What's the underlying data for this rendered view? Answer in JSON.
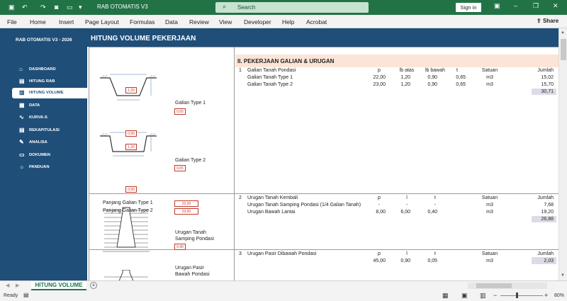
{
  "titlebar": {
    "title": "RAB OTOMATIS V3",
    "search_placeholder": "Search",
    "signin_label": "Sign in",
    "autosave_icon": "save-icon"
  },
  "ribbon": {
    "tabs": [
      "File",
      "Home",
      "Insert",
      "Page Layout",
      "Formulas",
      "Data",
      "Review",
      "View",
      "Developer",
      "Help",
      "Acrobat"
    ],
    "share_label": "Share"
  },
  "header": {
    "brand": "RAB OTOMATIS V3 - 2026",
    "page_title": "HITUNG VOLUME PEKERJAAN"
  },
  "sidebar": {
    "items": [
      {
        "label": "DASHBOARD",
        "icon": "⌂"
      },
      {
        "label": "HITUNG RAB",
        "icon": "▤"
      },
      {
        "label": "HITUNG VOLUME",
        "icon": "▥",
        "active": true
      },
      {
        "label": "DATA",
        "icon": "▦"
      },
      {
        "label": "KURVA-S",
        "icon": "∿"
      },
      {
        "label": "REKAPITULASI",
        "icon": "▤"
      },
      {
        "label": "ANALISA",
        "icon": "✎"
      },
      {
        "label": "DOKUMEN",
        "icon": "▭"
      },
      {
        "label": "PANDUAN",
        "icon": "☼"
      }
    ]
  },
  "section_title": "II. PEKERJAAN GALIAN & URUGAN",
  "galian": {
    "type1": {
      "label": "Galian Type 1",
      "top_width": "1,20",
      "depth": "0,65",
      "bottom_width": "0,90"
    },
    "type2": {
      "label": "Galian Type 2",
      "top_width": "1,20",
      "depth": "0,65",
      "bottom_width": "0,90"
    },
    "panjang1_label": "Panjang Galian Type 1",
    "panjang1_value": "22,00",
    "panjang2_label": "Panjang Galian Type 2",
    "panjang2_value": "23,00"
  },
  "urugan_tanah": {
    "label1": "Urugan Tanah",
    "label2": "Samping Pondasi",
    "depth": "0,40"
  },
  "urugan_pasir": {
    "label1": "Urugan Pasir",
    "label2": "Bawah Pondasi"
  },
  "block1": {
    "no": "1",
    "title": "Galian Tanah Pondasi",
    "headers": {
      "p": "p",
      "lb_atas": "lb atas",
      "lb_bawah": "lb bawah",
      "t": "t",
      "satuan": "Satuan",
      "jumlah": "Jumlah"
    },
    "rows": [
      {
        "name": "Galian Tanah Type 1",
        "p": "22,00",
        "lb_atas": "1,20",
        "lb_bawah": "0,90",
        "t": "0,65",
        "satuan": "m3",
        "jumlah": "15,02"
      },
      {
        "name": "Galian Tanah Type 2",
        "p": "23,00",
        "lb_atas": "1,20",
        "lb_bawah": "0,90",
        "t": "0,65",
        "satuan": "m3",
        "jumlah": "15,70"
      }
    ],
    "total": "30,71"
  },
  "block2": {
    "no": "2",
    "title": "Urugan Tanah Kembali",
    "headers": {
      "p": "p",
      "l": "l",
      "t": "t",
      "satuan": "Satuan",
      "jumlah": "Jumlah"
    },
    "rows": [
      {
        "name": "Urugan Tanah Samping Pondasi (1/4 Galian Tanah)",
        "p": "-",
        "l": "-",
        "t": "-",
        "satuan": "m3",
        "jumlah": "7,68"
      },
      {
        "name": "Urugan Bawah Lantai",
        "p": "8,00",
        "l": "6,00",
        "t": "0,40",
        "satuan": "m3",
        "jumlah": "19,20"
      }
    ],
    "total": "26,88"
  },
  "block3": {
    "no": "3",
    "title": "Urugan Pasir Dibawah Pondasi",
    "headers": {
      "p": "p",
      "l": "l",
      "t": "t",
      "satuan": "Satuan",
      "jumlah": "Jumlah"
    },
    "row": {
      "p": "45,00",
      "l": "0,90",
      "t": "0,05",
      "satuan": "m3",
      "jumlah": "2,03"
    }
  },
  "sheet_tab": "HITUNG VOLUME",
  "status": {
    "ready": "Ready",
    "zoom": "80%"
  },
  "colors": {
    "excel_green": "#217346",
    "navy": "#1f4e79",
    "section_bg": "#fce4d6",
    "total_bg": "#dcdce8",
    "input_red": "#c0392b"
  }
}
